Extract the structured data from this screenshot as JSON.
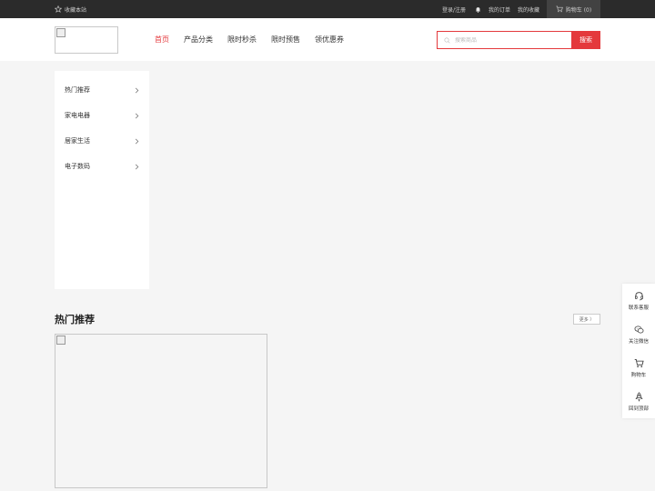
{
  "topbar": {
    "favorite": "收藏本站",
    "login": "登录/注册",
    "orders": "我的订单",
    "favorites": "我的收藏",
    "cart": "购物车 (0)",
    "icons": {
      "favorite": "star-icon",
      "bell": "bell-icon",
      "cart": "cart-icon"
    }
  },
  "header": {
    "nav": [
      {
        "label": "首页",
        "active": true
      },
      {
        "label": "产品分类"
      },
      {
        "label": "限时秒杀"
      },
      {
        "label": "限时预售"
      },
      {
        "label": "领优惠券"
      }
    ],
    "search": {
      "placeholder": "搜索商品",
      "button": "搜索"
    }
  },
  "categories": [
    {
      "label": "热门推荐"
    },
    {
      "label": "家电电器"
    },
    {
      "label": "居家生活"
    },
    {
      "label": "电子数码"
    }
  ],
  "section": {
    "title": "热门推荐",
    "more": "更多 〉"
  },
  "floatbar": [
    {
      "label": "联系客服",
      "icon": "headset-icon"
    },
    {
      "label": "关注微信",
      "icon": "wechat-icon"
    },
    {
      "label": "购物车",
      "icon": "cart-icon"
    },
    {
      "label": "回到顶部",
      "icon": "rocket-icon"
    }
  ],
  "colors": {
    "accent": "#e4393c",
    "topbar": "#2b2b2b",
    "background": "#f5f5f5"
  }
}
